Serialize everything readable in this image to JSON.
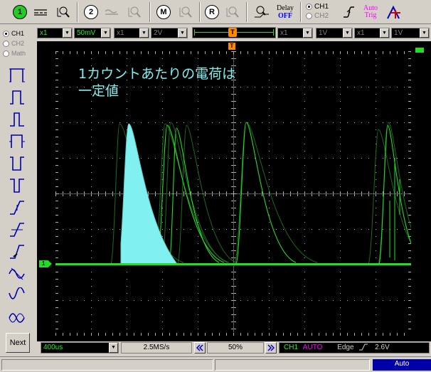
{
  "toolbar": {
    "btn1": "1",
    "btn2": "2",
    "btnM": "M",
    "btnR": "R",
    "delay_label": "Delay",
    "delay_value": "OFF",
    "trigger_ch1": "CH1",
    "trigger_ch2": "CH2",
    "autotrig_line1": "Auto",
    "autotrig_line2": "Trig"
  },
  "controls": {
    "ch1_probe": "x1",
    "ch1_vdiv": "50mV",
    "ch2_probe": "x1",
    "ch2_vdiv": "2V",
    "pos_marker": "T",
    "math_probe1": "x1",
    "math_vdiv1": "1V",
    "math_probe2": "x1",
    "math_vdiv2": "1V"
  },
  "left_panel": {
    "ch1": "CH1",
    "ch2": "CH2",
    "math": "Math",
    "next": "Next"
  },
  "screen": {
    "annotation_line1": "1カウントあたりの電荷は",
    "annotation_line2": "一定値",
    "ch1_marker": "1",
    "trigger_marker": "T",
    "colors": {
      "trace": "#22dd22",
      "fill": "#80f0f0",
      "grid": "#b0b0b0",
      "annotation": "#80f0f0"
    }
  },
  "bottom": {
    "timebase": "400us",
    "sample_rate": "2.5MS/s",
    "trigger_pos": "50%",
    "trig_source": "CH1",
    "trig_mode": "AUTO",
    "trig_type": "Edge",
    "trig_level": "2.6V"
  },
  "status": {
    "mode": "Auto"
  }
}
